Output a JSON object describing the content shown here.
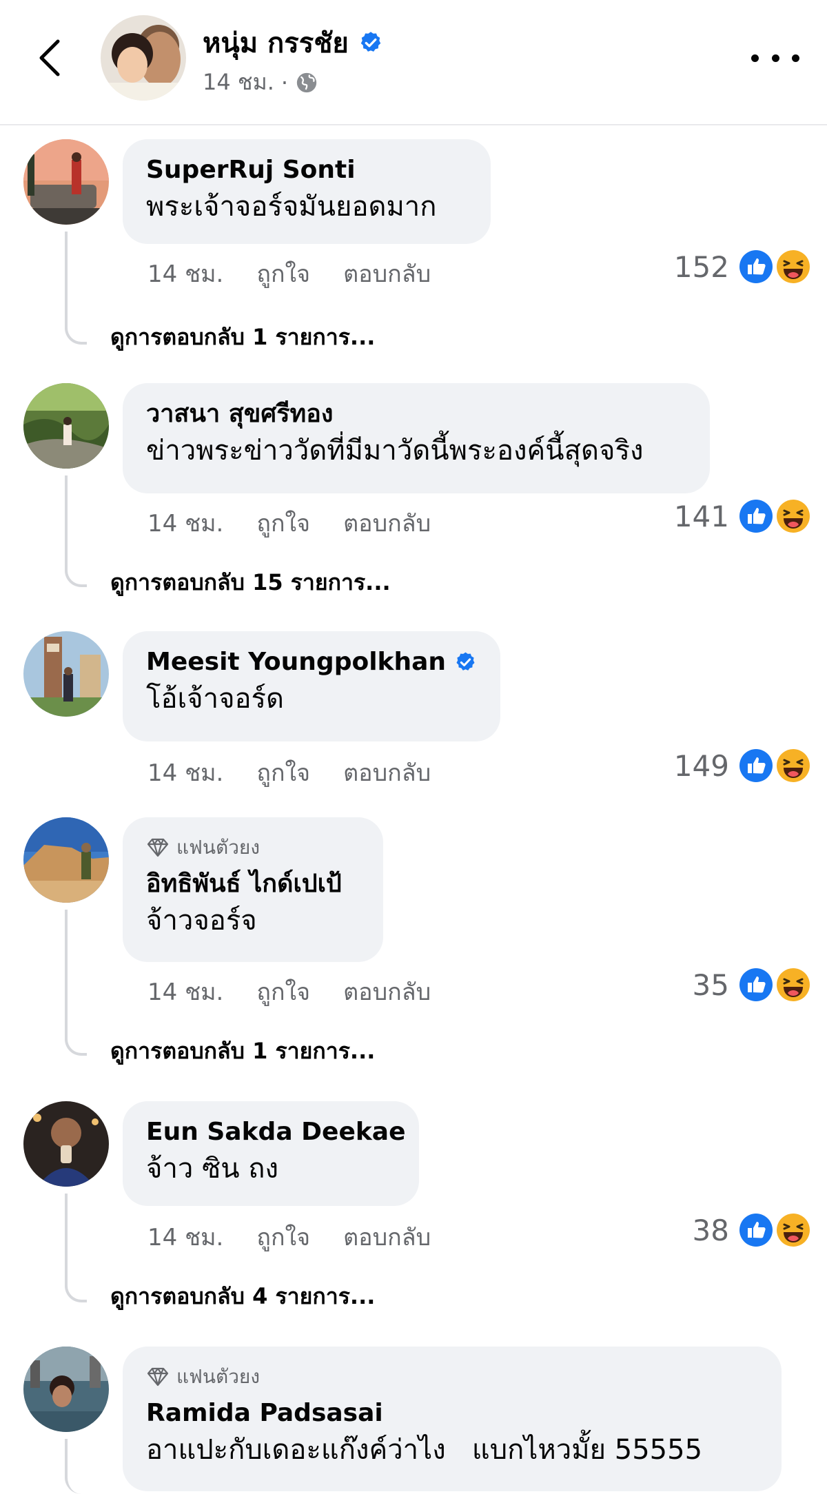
{
  "header": {
    "author_name": "หนุ่ม กรรชัย",
    "time": "14 ชม.",
    "separator": "·"
  },
  "comments": [
    {
      "author": "SuperRuj Sonti",
      "text": "พระเจ้าจอร์จมันยอดมาก",
      "time": "14 ชม.",
      "like_label": "ถูกใจ",
      "reply_label": "ตอบกลับ",
      "reaction_count": "152",
      "view_replies": "ดูการตอบกลับ 1 รายการ..."
    },
    {
      "author": "วาสนา สุขศรีทอง",
      "text": "ข่าวพระข่าววัดที่มีมาวัดนี้พระองค์นี้สุดจริง",
      "time": "14 ชม.",
      "like_label": "ถูกใจ",
      "reply_label": "ตอบกลับ",
      "reaction_count": "141",
      "view_replies": "ดูการตอบกลับ 15 รายการ..."
    },
    {
      "author": "Meesit Youngpolkhan",
      "verified": true,
      "text": "โอ้เจ้าจอร์ด",
      "time": "14 ชม.",
      "like_label": "ถูกใจ",
      "reply_label": "ตอบกลับ",
      "reaction_count": "149"
    },
    {
      "badge": "แฟนตัวยง",
      "author": "อิทธิพันธ์ ไกด์เปเป้",
      "text": "จ้าวจอร์จ",
      "time": "14 ชม.",
      "like_label": "ถูกใจ",
      "reply_label": "ตอบกลับ",
      "reaction_count": "35",
      "view_replies": "ดูการตอบกลับ 1 รายการ..."
    },
    {
      "author": "Eun Sakda Deekae",
      "text": "จ้าว ซิน ถง",
      "time": "14 ชม.",
      "like_label": "ถูกใจ",
      "reply_label": "ตอบกลับ",
      "reaction_count": "38",
      "view_replies": "ดูการตอบกลับ 4 รายการ..."
    },
    {
      "badge": "แฟนตัวยง",
      "author": "Ramida Padsasai",
      "text": "อาแปะกับเดอะแก๊งค์ว่าไง   แบกไหวมั้ย 55555"
    }
  ],
  "icons": {
    "back": "chevron-left-icon",
    "verified": "verified-badge-icon",
    "globe": "globe-icon",
    "more": "more-dots-icon",
    "like": "like-reaction-icon",
    "haha": "haha-reaction-icon",
    "fan": "diamond-icon"
  },
  "colors": {
    "facebook_blue": "#1877f2",
    "haha_yellow": "#f7b125",
    "bubble_bg": "#f0f2f5",
    "secondary_text": "#65676b"
  }
}
